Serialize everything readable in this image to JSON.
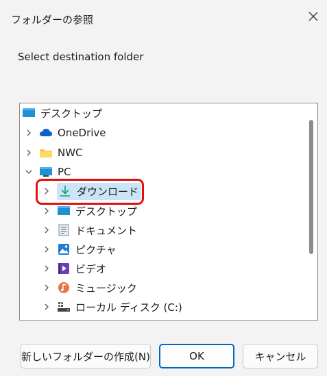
{
  "dialog": {
    "title": "フォルダーの参照",
    "prompt": "Select destination folder"
  },
  "tree": {
    "items": [
      {
        "label": "デスクトップ",
        "icon": "desktop-icon",
        "level": 0,
        "expand": "none"
      },
      {
        "label": "OneDrive",
        "icon": "cloud-icon",
        "level": 1,
        "expand": "collapsed"
      },
      {
        "label": "NWC",
        "icon": "folder-icon",
        "level": 1,
        "expand": "collapsed"
      },
      {
        "label": "PC",
        "icon": "pc-icon",
        "level": 1,
        "expand": "expanded"
      },
      {
        "label": "ダウンロード",
        "icon": "download-icon",
        "level": 2,
        "expand": "collapsed",
        "selected": true
      },
      {
        "label": "デスクトップ",
        "icon": "desktop-icon",
        "level": 2,
        "expand": "collapsed"
      },
      {
        "label": "ドキュメント",
        "icon": "document-icon",
        "level": 2,
        "expand": "collapsed"
      },
      {
        "label": "ピクチャ",
        "icon": "pictures-icon",
        "level": 2,
        "expand": "collapsed"
      },
      {
        "label": "ビデオ",
        "icon": "video-icon",
        "level": 2,
        "expand": "collapsed"
      },
      {
        "label": "ミュージック",
        "icon": "music-icon",
        "level": 2,
        "expand": "collapsed"
      },
      {
        "label": "ローカル ディスク (C:)",
        "icon": "drive-icon",
        "level": 2,
        "expand": "collapsed"
      }
    ]
  },
  "buttons": {
    "new_folder": "新しいフォルダーの作成(N)",
    "ok": "OK",
    "cancel": "キャンセル"
  },
  "colors": {
    "highlight_border": "#e01010",
    "selection": "#cce4f7",
    "primary_border": "#0067c0"
  }
}
